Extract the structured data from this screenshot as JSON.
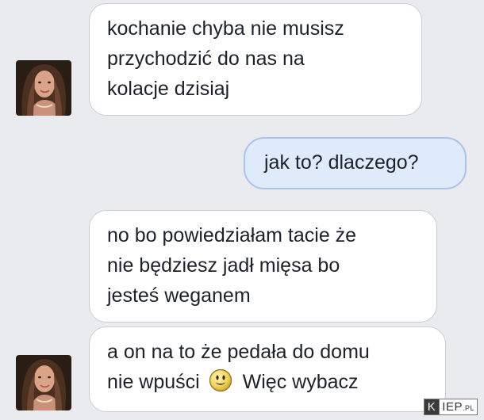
{
  "messages": [
    {
      "direction": "incoming",
      "lines": [
        "kochanie chyba nie musisz",
        "przychodzić do nas na",
        "kolacje dzisiaj"
      ]
    },
    {
      "direction": "outgoing",
      "lines": [
        "jak to? dlaczego?"
      ]
    },
    {
      "direction": "incoming",
      "lines": [
        "no bo powiedziałam tacie że",
        "nie będziesz jadł mięsa bo",
        "jesteś weganem"
      ]
    },
    {
      "direction": "incoming",
      "line1": "a on na to że pedała do domu",
      "line2_before_emoji": "nie wpuści",
      "emoji": "smiley-emoji",
      "line2_after_emoji": "Więc wybacz"
    }
  ],
  "watermark": {
    "part1": "K",
    "part2": "IEP",
    "suffix": ".PL"
  },
  "colors": {
    "background": "#e9ebee",
    "incoming_bubble": "#ffffff",
    "outgoing_bubble": "#dfeafb",
    "outgoing_border": "#a9c4ea"
  }
}
